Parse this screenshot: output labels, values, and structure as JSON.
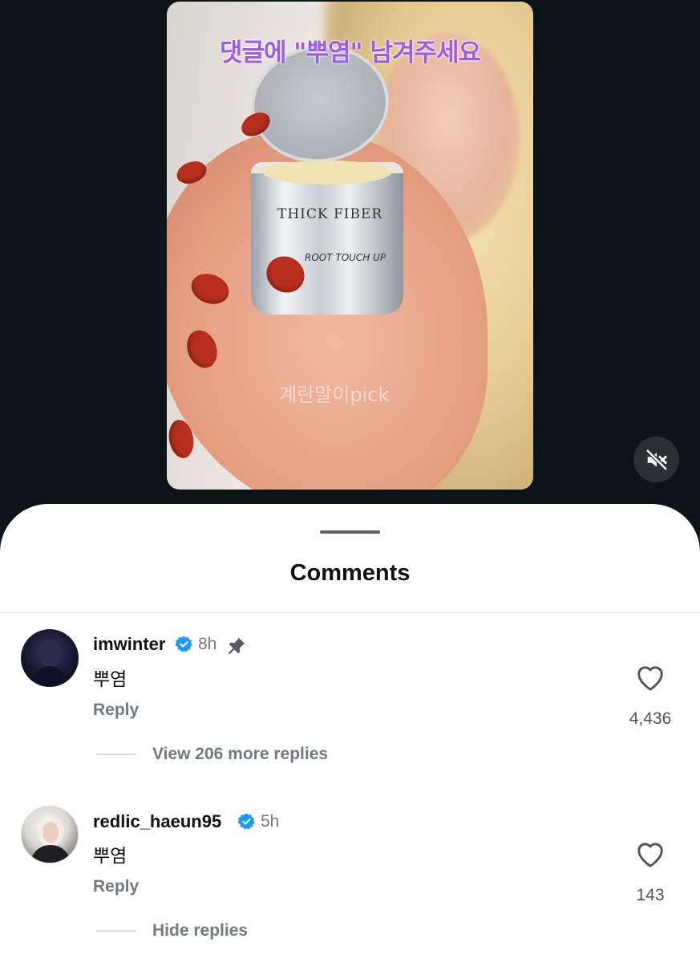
{
  "video": {
    "overlay_text": "댓글에 \"뿌염\" 남겨주세요",
    "product_label": "THICK FIBER",
    "product_sub": "ROOT TOUCH UP",
    "watermark": "계란말이pick"
  },
  "sheet": {
    "title": "Comments"
  },
  "comments": [
    {
      "username": "imwinter",
      "verified": true,
      "time": "8h",
      "pinned": true,
      "text": "뿌염",
      "reply_label": "Reply",
      "likes": "4,436",
      "replies_label": "View 206 more replies"
    },
    {
      "username": "redlic_haeun95",
      "verified": true,
      "time": "5h",
      "pinned": false,
      "text": "뿌염",
      "reply_label": "Reply",
      "likes": "143",
      "replies_label": "Hide replies"
    }
  ],
  "colors": {
    "background": "#0c1418",
    "overlay_text": "#9b5de5",
    "verified_badge": "#1d9bf0",
    "muted_text": "#737a80"
  },
  "icons": {
    "mute": "speaker-muted-icon",
    "verified": "verified-badge-icon",
    "pin": "pin-icon",
    "like": "heart-outline-icon"
  }
}
